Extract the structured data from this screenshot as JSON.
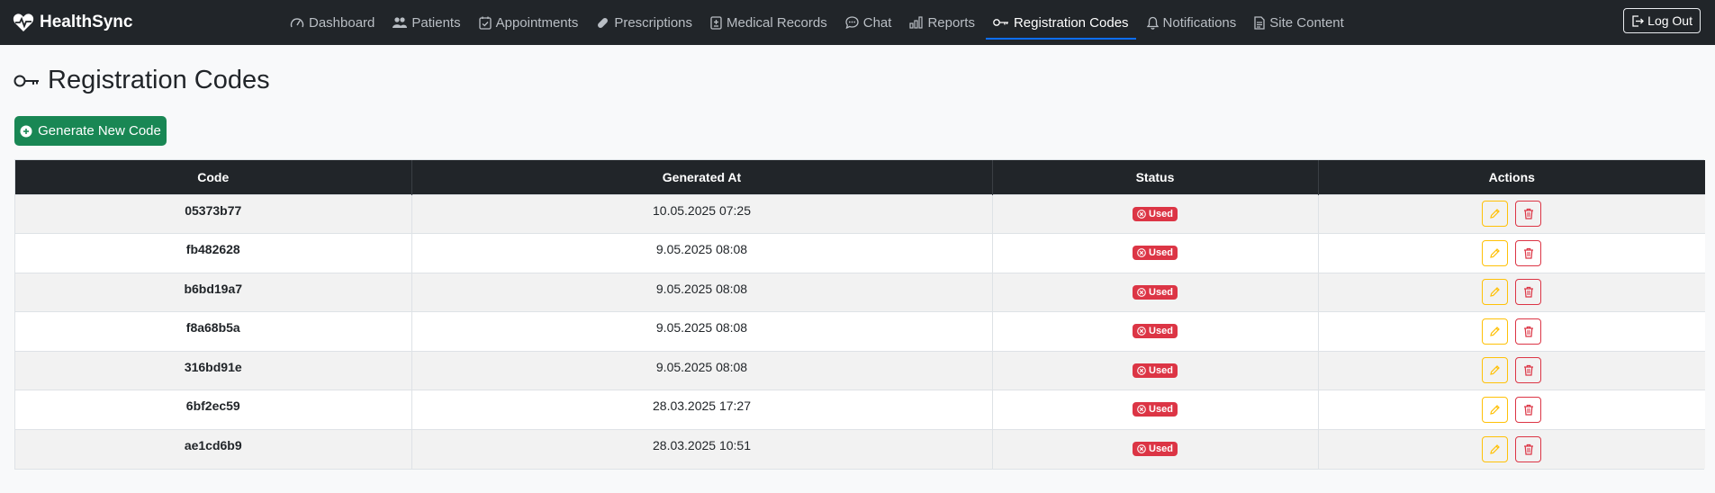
{
  "brand": {
    "name": "HealthSync"
  },
  "nav": {
    "items": [
      {
        "label": "Dashboard",
        "icon": "dashboard-icon"
      },
      {
        "label": "Patients",
        "icon": "people-icon"
      },
      {
        "label": "Appointments",
        "icon": "calendar-check-icon"
      },
      {
        "label": "Prescriptions",
        "icon": "capsule-icon"
      },
      {
        "label": "Medical Records",
        "icon": "medical-file-icon"
      },
      {
        "label": "Chat",
        "icon": "chat-icon"
      },
      {
        "label": "Reports",
        "icon": "bar-chart-icon"
      },
      {
        "label": "Registration Codes",
        "icon": "key-icon",
        "active": true
      },
      {
        "label": "Notifications",
        "icon": "bell-icon"
      },
      {
        "label": "Site Content",
        "icon": "document-icon"
      }
    ],
    "logout_label": "Log Out"
  },
  "page": {
    "title": "Registration Codes",
    "generate_button": "Generate New Code"
  },
  "table": {
    "headers": [
      "Code",
      "Generated At",
      "Status",
      "Actions"
    ],
    "rows": [
      {
        "code": "05373b77",
        "generated_at": "10.05.2025 07:25",
        "status": "Used"
      },
      {
        "code": "fb482628",
        "generated_at": "9.05.2025 08:08",
        "status": "Used"
      },
      {
        "code": "b6bd19a7",
        "generated_at": "9.05.2025 08:08",
        "status": "Used"
      },
      {
        "code": "f8a68b5a",
        "generated_at": "9.05.2025 08:08",
        "status": "Used"
      },
      {
        "code": "316bd91e",
        "generated_at": "9.05.2025 08:08",
        "status": "Used"
      },
      {
        "code": "6bf2ec59",
        "generated_at": "28.03.2025 17:27",
        "status": "Used"
      },
      {
        "code": "ae1cd6b9",
        "generated_at": "28.03.2025 10:51",
        "status": "Used"
      }
    ]
  },
  "colors": {
    "navbar": "#212529",
    "primary_accent": "#0d6efd",
    "success": "#198754",
    "danger": "#dc3545",
    "warning": "#ffc107"
  }
}
